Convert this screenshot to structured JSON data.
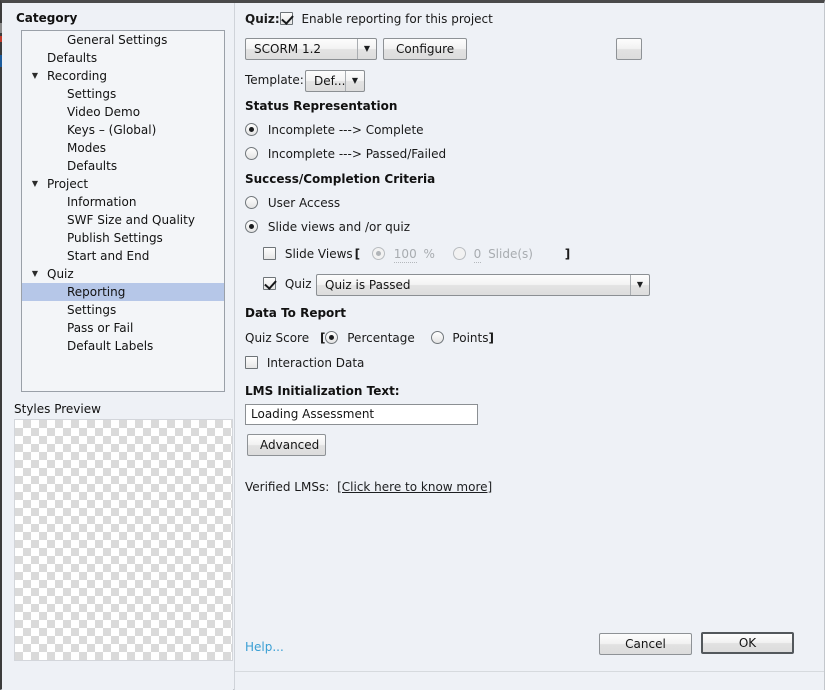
{
  "sidebar": {
    "heading": "Category",
    "items": [
      {
        "label": "General Settings",
        "level": "a",
        "twisty": "",
        "selected": false
      },
      {
        "label": "Defaults",
        "level": "b",
        "twisty": "",
        "selected": false
      },
      {
        "label": "Recording",
        "level": "b",
        "twisty": "▼",
        "selected": false
      },
      {
        "label": "Settings",
        "level": "c",
        "twisty": "",
        "selected": false
      },
      {
        "label": "Video Demo",
        "level": "c",
        "twisty": "",
        "selected": false
      },
      {
        "label": "Keys – (Global)",
        "level": "c",
        "twisty": "",
        "selected": false
      },
      {
        "label": "Modes",
        "level": "c",
        "twisty": "",
        "selected": false
      },
      {
        "label": "Defaults",
        "level": "c",
        "twisty": "",
        "selected": false
      },
      {
        "label": "Project",
        "level": "b",
        "twisty": "▼",
        "selected": false
      },
      {
        "label": "Information",
        "level": "c",
        "twisty": "",
        "selected": false
      },
      {
        "label": "SWF Size and Quality",
        "level": "c",
        "twisty": "",
        "selected": false
      },
      {
        "label": "Publish Settings",
        "level": "c",
        "twisty": "",
        "selected": false
      },
      {
        "label": "Start and End",
        "level": "c",
        "twisty": "",
        "selected": false
      },
      {
        "label": "Quiz",
        "level": "b",
        "twisty": "▼",
        "selected": false
      },
      {
        "label": "Reporting",
        "level": "c",
        "twisty": "",
        "selected": true
      },
      {
        "label": "Settings",
        "level": "c",
        "twisty": "",
        "selected": false
      },
      {
        "label": "Pass or Fail",
        "level": "c",
        "twisty": "",
        "selected": false
      },
      {
        "label": "Default Labels",
        "level": "c",
        "twisty": "",
        "selected": false
      }
    ],
    "styles_preview_heading": "Styles Preview"
  },
  "main": {
    "quiz_label": "Quiz:",
    "enable_reporting_label": "Enable reporting for this project",
    "enable_reporting_checked": true,
    "lms_standard": "SCORM 1.2",
    "configure_label": "Configure",
    "template_label": "Template:",
    "template_value": "Def...",
    "status_representation_title": "Status Representation",
    "status_option_1": "Incomplete ---> Complete",
    "status_option_2": "Incomplete ---> Passed/Failed",
    "status_selected": 1,
    "success_criteria_title": "Success/Completion Criteria",
    "criteria_option_1": "User Access",
    "criteria_option_2": "Slide views and /or quiz",
    "criteria_selected": 2,
    "slide_views_label": "Slide Views",
    "slide_views_checked": false,
    "bracket_open": "[",
    "bracket_close": "]",
    "percent_value": "100",
    "percent_unit": "%",
    "slides_value": "0",
    "slides_unit": "Slide(s)",
    "slide_metric_selected": "percent",
    "quiz_criteria_label": "Quiz",
    "quiz_criteria_checked": true,
    "quiz_condition": "Quiz is Passed",
    "data_to_report_title": "Data To Report",
    "quiz_score_label": "Quiz Score",
    "percentage_label": "Percentage",
    "points_label": "Points",
    "quiz_score_selected": "percentage",
    "interaction_data_label": "Interaction Data",
    "interaction_data_checked": false,
    "lms_init_title": "LMS Initialization Text:",
    "lms_init_value": "Loading Assessment",
    "advanced_label": "Advanced",
    "verified_lms_label": "Verified LMSs:",
    "verified_lms_link": "[Click here to know more]"
  },
  "footer": {
    "help_label": "Help...",
    "cancel_label": "Cancel",
    "ok_label": "OK"
  },
  "colors": {
    "window_bg": "#eef1f6",
    "selection": "#b6c7e8",
    "link": "#3a9fd4"
  }
}
